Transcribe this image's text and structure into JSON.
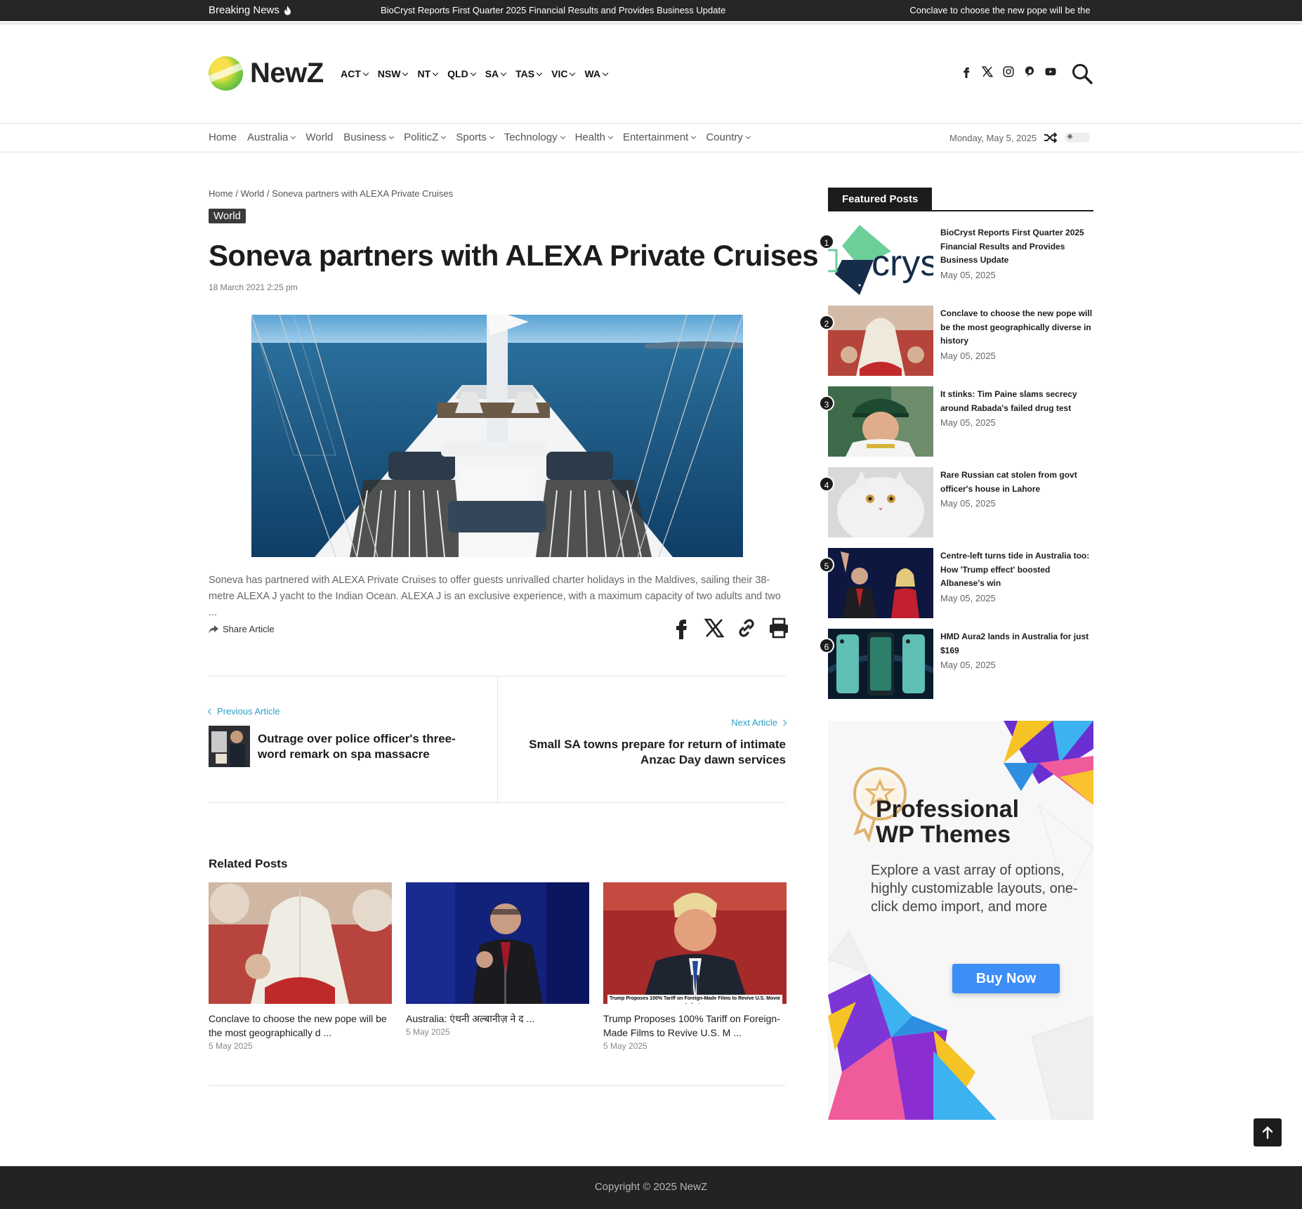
{
  "breaking": {
    "label": "Breaking News",
    "items": [
      "BioCryst Reports First Quarter 2025 Financial Results and Provides Business Update",
      "Conclave to choose the new pope will be the most geogra"
    ]
  },
  "brand": {
    "name": "NewZ"
  },
  "state_nav": [
    "ACT",
    "NSW",
    "NT",
    "QLD",
    "SA",
    "TAS",
    "VIC",
    "WA"
  ],
  "socials": [
    "facebook-icon",
    "x-icon",
    "instagram-icon",
    "pinterest-icon",
    "youtube-icon"
  ],
  "main_nav": [
    {
      "label": "Home",
      "dropdown": false
    },
    {
      "label": "Australia",
      "dropdown": true
    },
    {
      "label": "World",
      "dropdown": false
    },
    {
      "label": "Business",
      "dropdown": true
    },
    {
      "label": "PoliticZ",
      "dropdown": true
    },
    {
      "label": "Sports",
      "dropdown": true
    },
    {
      "label": "Technology",
      "dropdown": true
    },
    {
      "label": "Health",
      "dropdown": true
    },
    {
      "label": "Entertainment",
      "dropdown": true
    },
    {
      "label": "Country",
      "dropdown": true
    }
  ],
  "date_display": "Monday, May 5, 2025",
  "breadcrumb": {
    "home": "Home",
    "section": "World",
    "current": "Soneva partners with ALEXA Private Cruises",
    "sep": "/"
  },
  "article": {
    "category": "World",
    "title": "Soneva partners with ALEXA Private Cruises",
    "date": "18 March 2021 2:25 pm",
    "excerpt": "Soneva has partnered with ALEXA Private Cruises to offer guests unrivalled charter holidays in the Maldives, sailing their 38-metre ALEXA J yacht to the Indian Ocean. ALEXA J is an exclusive experience, with a maximum capacity of two adults and two ...",
    "share_label": "Share Article"
  },
  "post_nav": {
    "prev_label": "Previous Article",
    "prev_title": "Outrage over police officer's three-word remark on spa massacre",
    "next_label": "Next Article",
    "next_title": "Small SA towns prepare for return of intimate Anzac Day dawn services"
  },
  "related": {
    "heading": "Related Posts",
    "posts": [
      {
        "title": "Conclave to choose the new pope will be the most geographically d ...",
        "date": "5 May 2025"
      },
      {
        "title": "Australia: एंथनी अल्बानीज़ ने द ...",
        "date": "5 May 2025"
      },
      {
        "title": "Trump Proposes 100% Tariff on Foreign-Made Films to Revive U.S. M ...",
        "date": "5 May 2025",
        "caption": "Trump Proposes 100% Tariff on Foreign-Made Films to Revive U.S. Movie Industry"
      }
    ]
  },
  "featured": {
    "heading": "Featured Posts",
    "posts": [
      {
        "num": "1",
        "title": "BioCryst Reports First Quarter 2025 Financial Results and Provides Business Update",
        "date": "May 05, 2025"
      },
      {
        "num": "2",
        "title": "Conclave to choose the new pope will be the most geographically diverse in history",
        "date": "May 05, 2025"
      },
      {
        "num": "3",
        "title": "It stinks: Tim Paine slams secrecy around Rabada's failed drug test",
        "date": "May 05, 2025"
      },
      {
        "num": "4",
        "title": "Rare Russian cat stolen from govt officer's house in Lahore",
        "date": "May 05, 2025"
      },
      {
        "num": "5",
        "title": "Centre-left turns tide in Australia too: How 'Trump effect' boosted Albanese's win",
        "date": "May 05, 2025"
      },
      {
        "num": "6",
        "title": "HMD Aura2 lands in Australia for just $169",
        "date": "May 05, 2025"
      }
    ]
  },
  "ad": {
    "title_line1": "Professional",
    "title_line2": "WP Themes",
    "text": "Explore a vast array of options, highly customizable layouts, one-click demo import, and more",
    "button": "Buy Now"
  },
  "footer": {
    "copyright": "Copyright © 2025 NewZ"
  },
  "colors": {
    "accent": "#2aa1c6",
    "dark": "#1c1c1c",
    "ad_button": "#3d8ef7"
  }
}
